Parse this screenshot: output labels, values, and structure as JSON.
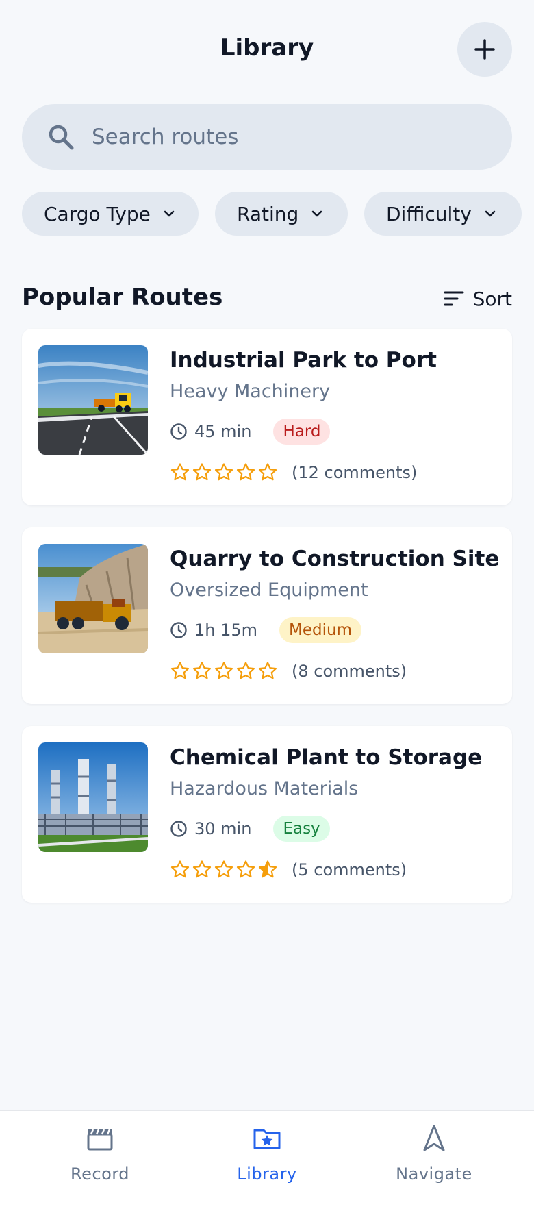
{
  "header": {
    "title": "Library",
    "add_icon": "plus-icon"
  },
  "search": {
    "placeholder": "Search routes",
    "value": "",
    "icon": "search-icon"
  },
  "filters": [
    {
      "label": "Cargo Type"
    },
    {
      "label": "Rating"
    },
    {
      "label": "Difficulty"
    }
  ],
  "section": {
    "title": "Popular Routes",
    "sort_label": "Sort"
  },
  "routes": [
    {
      "title": "Industrial Park to Port",
      "cargo": "Heavy Machinery",
      "duration": "45 min",
      "difficulty": "Hard",
      "rating": 5,
      "comments": "(12 comments)",
      "image": "highway-truck"
    },
    {
      "title": "Quarry to Construction Site",
      "cargo": "Oversized Equipment",
      "duration": "1h 15m",
      "difficulty": "Medium",
      "rating": 5,
      "comments": "(8 comments)",
      "image": "quarry-hauler"
    },
    {
      "title": "Chemical Plant to Storage",
      "cargo": "Hazardous Materials",
      "duration": "30 min",
      "difficulty": "Easy",
      "rating": 4.5,
      "comments": "(5 comments)",
      "image": "chemical-plant"
    }
  ],
  "nav": {
    "items": [
      {
        "label": "Record",
        "icon": "clapperboard-icon",
        "active": false
      },
      {
        "label": "Library",
        "icon": "folder-star-icon",
        "active": true
      },
      {
        "label": "Navigate",
        "icon": "navigation-arrow-icon",
        "active": false
      }
    ]
  },
  "colors": {
    "accent": "#2563eb",
    "star": "#f59e0b",
    "hard_bg": "#fee2e2",
    "hard_text": "#b91c1c",
    "medium_bg": "#fef3c7",
    "medium_text": "#b45309",
    "easy_bg": "#dcfce7",
    "easy_text": "#15803d"
  }
}
